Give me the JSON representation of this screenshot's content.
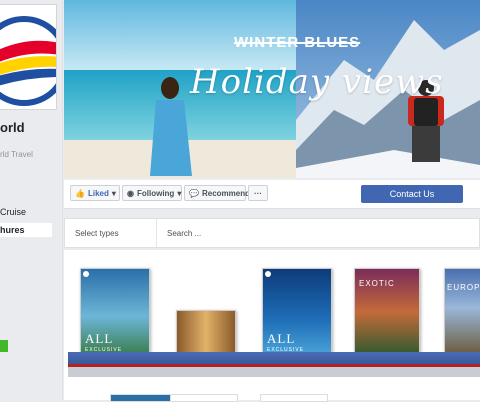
{
  "colors": {
    "fb_blue": "#4267b2",
    "bg": "#e9ebee",
    "shelf_blue": "#3b5998",
    "shelf_red": "#b22222"
  },
  "sidebar": {
    "brand_name": "orld",
    "brand_sub": "rld Travel",
    "items": [
      {
        "label": "Cruise"
      },
      {
        "label": "hures",
        "active": true
      }
    ]
  },
  "cover": {
    "strike_text": "WINTER BLUES",
    "headline": "Holiday views"
  },
  "toolbar": {
    "liked": "Liked",
    "following": "Following",
    "recommend": "Recommend",
    "more": "···",
    "contact": "Contact Us"
  },
  "filter": {
    "types_placeholder": "Select types",
    "search_placeholder": "Search ..."
  },
  "brochures": [
    {
      "title": "ALL",
      "subtitle": "EXCLUSIVE"
    },
    {
      "title": "",
      "subtitle": ""
    },
    {
      "title": "ALL",
      "subtitle": "EXCLUSIVE"
    },
    {
      "title": "EXOTIC",
      "subtitle": ""
    },
    {
      "title": "EUROPE",
      "subtitle": ""
    }
  ]
}
